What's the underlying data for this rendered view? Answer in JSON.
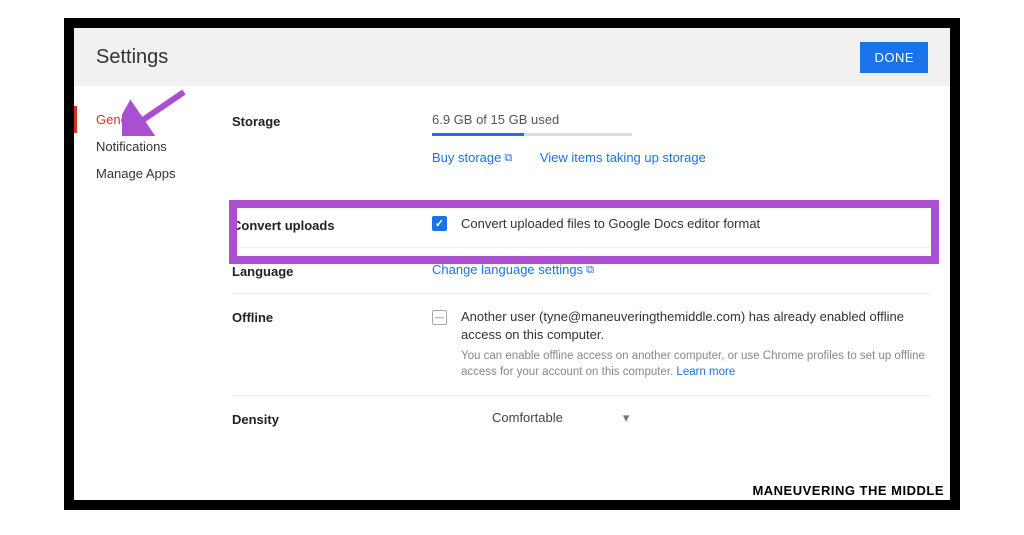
{
  "header": {
    "title": "Settings",
    "done_label": "DONE"
  },
  "sidebar": {
    "items": [
      {
        "label": "General"
      },
      {
        "label": "Notifications"
      },
      {
        "label": "Manage Apps"
      }
    ]
  },
  "storage": {
    "label": "Storage",
    "usage_text": "6.9 GB of 15 GB used",
    "buy_link": "Buy storage",
    "view_link": "View items taking up storage"
  },
  "convert": {
    "label": "Convert uploads",
    "checkbox_label": "Convert uploaded files to Google Docs editor format"
  },
  "language": {
    "label": "Language",
    "link": "Change language settings"
  },
  "offline": {
    "label": "Offline",
    "main_text": "Another user (tyne@maneuveringthemiddle.com) has already enabled offline access on this computer.",
    "sub_text": "You can enable offline access on another computer, or use Chrome profiles to set up offline access for your account on this computer. ",
    "learn_more": "Learn more"
  },
  "density": {
    "label": "Density",
    "value": "Comfortable"
  },
  "attribution": "MANEUVERING THE MIDDLE",
  "annotation_color": "#a94fd0"
}
